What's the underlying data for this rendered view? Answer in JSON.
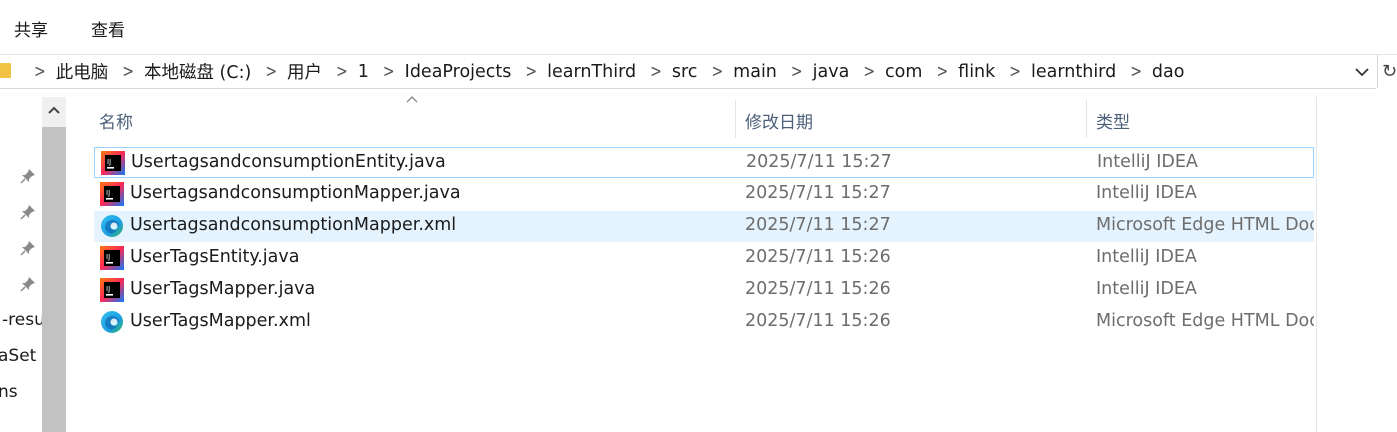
{
  "ribbon": {
    "tabs": [
      "共享",
      "查看"
    ]
  },
  "address": {
    "crumbs": [
      "此电脑",
      "本地磁盘 (C:)",
      "用户",
      "1",
      "IdeaProjects",
      "learnThird",
      "src",
      "main",
      "java",
      "com",
      "flink",
      "learnthird",
      "dao"
    ]
  },
  "nav": {
    "items": [
      "-resu",
      "aSet",
      "ns"
    ]
  },
  "columns": {
    "name": "名称",
    "date": "修改日期",
    "type": "类型"
  },
  "files": [
    {
      "name": "UsertagsandconsumptionEntity.java",
      "date": "2025/7/11 15:27",
      "type": "IntelliJ IDEA",
      "icon": "intellij-icon"
    },
    {
      "name": "UsertagsandconsumptionMapper.java",
      "date": "2025/7/11 15:27",
      "type": "IntelliJ IDEA",
      "icon": "intellij-icon"
    },
    {
      "name": "UsertagsandconsumptionMapper.xml",
      "date": "2025/7/11 15:27",
      "type": "Microsoft Edge HTML Document",
      "icon": "edge-icon"
    },
    {
      "name": "UserTagsEntity.java",
      "date": "2025/7/11 15:26",
      "type": "IntelliJ IDEA",
      "icon": "intellij-icon"
    },
    {
      "name": "UserTagsMapper.java",
      "date": "2025/7/11 15:26",
      "type": "IntelliJ IDEA",
      "icon": "intellij-icon"
    },
    {
      "name": "UserTagsMapper.xml",
      "date": "2025/7/11 15:26",
      "type": "Microsoft Edge HTML Document",
      "icon": "edge-icon"
    }
  ],
  "colors": {
    "hover_row": "#e5f3ff",
    "focus_border": "#99d1ff",
    "header_text": "#4c607a",
    "meta_text": "#6d6d6d"
  }
}
